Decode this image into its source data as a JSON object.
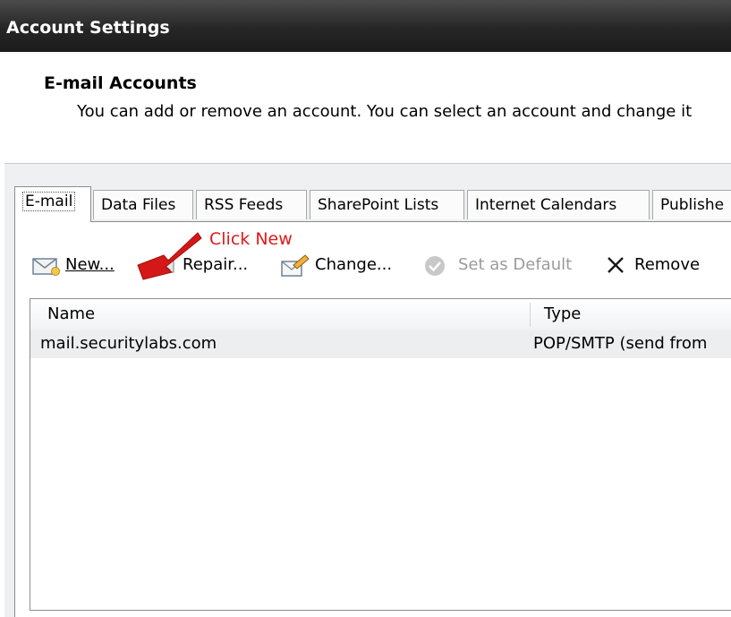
{
  "window": {
    "title": "Account Settings"
  },
  "header": {
    "title": "E-mail Accounts",
    "description": "You can add or remove an account. You can select an account and change it"
  },
  "tabs": [
    {
      "label": "E-mail",
      "active": true
    },
    {
      "label": "Data Files"
    },
    {
      "label": "RSS Feeds"
    },
    {
      "label": "SharePoint Lists"
    },
    {
      "label": "Internet Calendars"
    },
    {
      "label": "Publishe"
    }
  ],
  "toolbar": {
    "new_label": "New...",
    "repair_label": "Repair...",
    "change_label": "Change...",
    "set_default_label": "Set as Default",
    "remove_label": "Remove"
  },
  "annotation": {
    "text": "Click New",
    "color": "#e01a1a"
  },
  "list": {
    "columns": [
      "Name",
      "Type"
    ],
    "rows": [
      {
        "name": "mail.securitylabs.com",
        "type": "POP/SMTP (send from"
      }
    ]
  },
  "icons": {
    "new": "envelope-new-icon",
    "repair": "repair-icon",
    "change": "change-icon",
    "set_default": "checkmark-circle-icon",
    "remove": "x-icon"
  }
}
